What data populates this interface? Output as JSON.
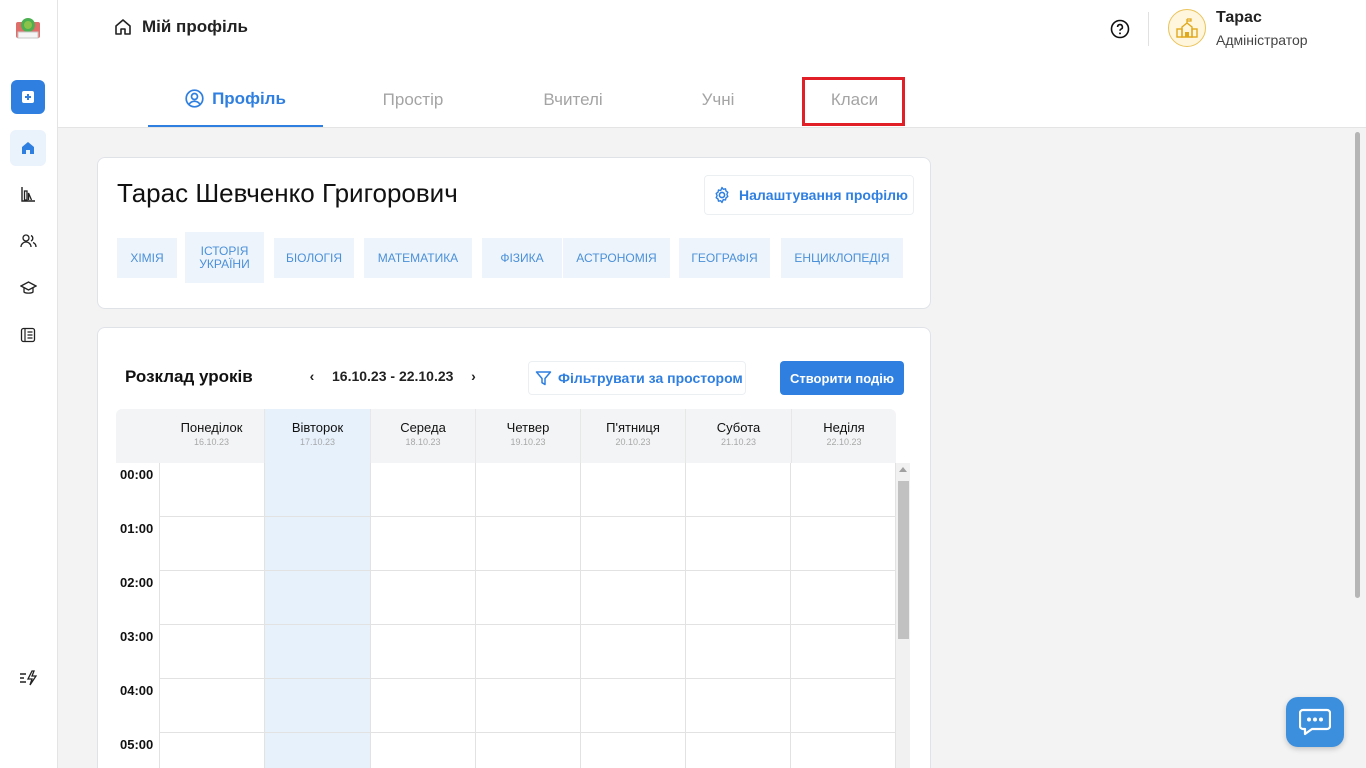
{
  "header": {
    "breadcrumb": "Мій профіль",
    "user": {
      "name": "Тарас",
      "role": "Адміністратор"
    }
  },
  "tabs": [
    {
      "label": "Профіль",
      "active": true
    },
    {
      "label": "Простір",
      "active": false
    },
    {
      "label": "Вчителі",
      "active": false
    },
    {
      "label": "Учні",
      "active": false
    },
    {
      "label": "Класи",
      "active": false
    }
  ],
  "profile": {
    "full_name": "Тарас Шевченко Григорович",
    "settings_label": "Налаштування профілю",
    "subjects": [
      "Хімія",
      "Історія України",
      "Біологія",
      "Математика",
      "Фізика",
      "Астрономія",
      "Географія",
      "Енциклопедія"
    ]
  },
  "schedule": {
    "title": "Розклад уроків",
    "range": "16.10.23 - 22.10.23",
    "prev": "‹",
    "next": "›",
    "filter_label": "Фільтрувати за простором",
    "create_label": "Створити подію",
    "days": [
      {
        "name": "Понеділок",
        "date": "16.10.23"
      },
      {
        "name": "Вівторок",
        "date": "17.10.23",
        "today": true
      },
      {
        "name": "Середа",
        "date": "18.10.23"
      },
      {
        "name": "Четвер",
        "date": "19.10.23"
      },
      {
        "name": "П'ятниця",
        "date": "20.10.23"
      },
      {
        "name": "Субота",
        "date": "21.10.23"
      },
      {
        "name": "Неділя",
        "date": "22.10.23"
      }
    ],
    "hours": [
      "00:00",
      "01:00",
      "02:00",
      "03:00",
      "04:00",
      "05:00"
    ]
  },
  "icons": {
    "sidebar": [
      "add-icon",
      "home-icon",
      "chart-icon",
      "users-icon",
      "graduation-icon",
      "journal-icon",
      "automation-icon"
    ],
    "chat": "chat-icon"
  },
  "colors": {
    "accent": "#2f7fe0",
    "highlight": "#e01f26",
    "today_bg": "#e6f1fc"
  }
}
